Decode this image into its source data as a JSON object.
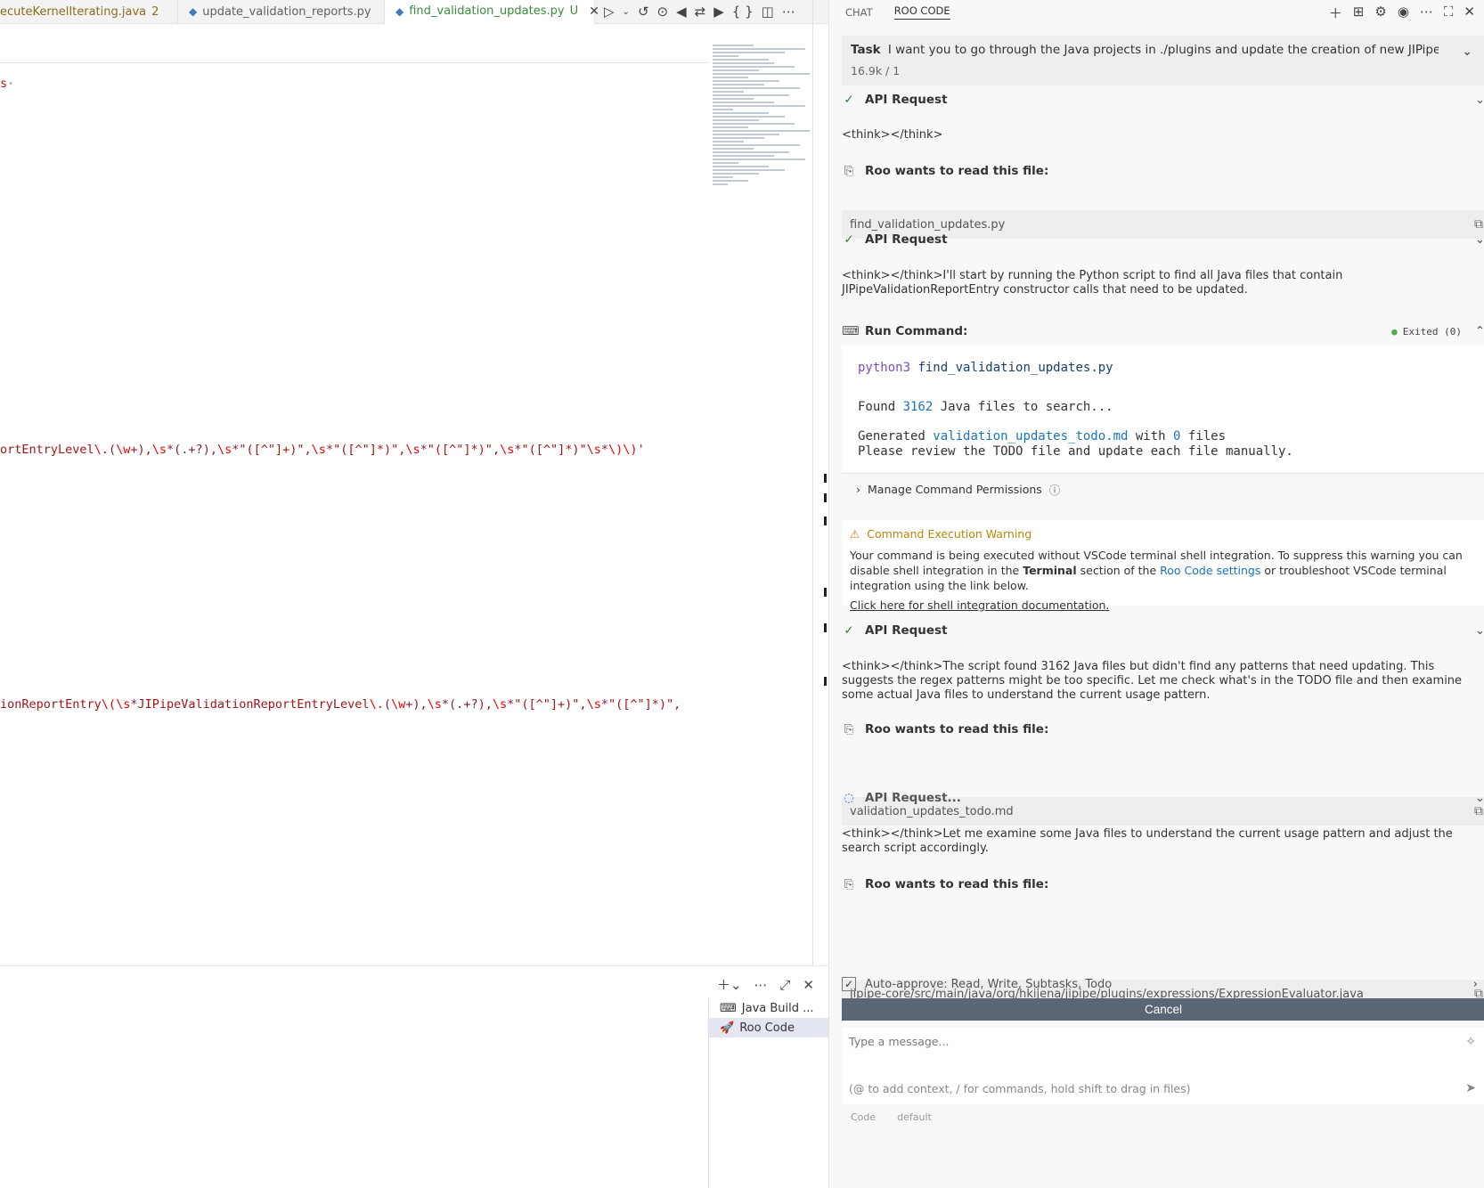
{
  "editor": {
    "tabs": [
      {
        "label": "ecuteKernelIterating.java",
        "badge": "2"
      },
      {
        "label": "update_validation_reports.py"
      },
      {
        "label": "find_validation_updates.py",
        "badge": "U"
      }
    ],
    "code_lines": [
      {
        "parts": [
          {
            "t": "s",
            "c": "str"
          },
          {
            "t": "·",
            "c": "dim"
          }
        ]
      },
      {
        "parts": [
          {
            "t": "ortEntryLevel",
            "c": "str"
          },
          {
            "t": "\\.",
            "c": "esc"
          },
          {
            "t": "(",
            "c": "grp"
          },
          {
            "t": "\\w",
            "c": "esc"
          },
          {
            "t": "+)",
            "c": "grp"
          },
          {
            "t": ",",
            "c": "str"
          },
          {
            "t": "\\s",
            "c": "esc"
          },
          {
            "t": "*",
            "c": "grp"
          },
          {
            "t": "(.",
            "c": "grp"
          },
          {
            "t": "+?",
            "c": "grp"
          },
          {
            "t": ")",
            "c": "grp"
          },
          {
            "t": ",",
            "c": "str"
          },
          {
            "t": "\\s",
            "c": "esc"
          },
          {
            "t": "*",
            "c": "grp"
          },
          {
            "t": "\"([^\"]+)\"",
            "c": "str"
          },
          {
            "t": ",",
            "c": "str"
          },
          {
            "t": "\\s",
            "c": "esc"
          },
          {
            "t": "*",
            "c": "grp"
          },
          {
            "t": "\"([^\"]*)\"",
            "c": "str"
          },
          {
            "t": ",",
            "c": "str"
          },
          {
            "t": "\\s",
            "c": "esc"
          },
          {
            "t": "*",
            "c": "grp"
          },
          {
            "t": "\"([^\"]*)\"",
            "c": "str"
          },
          {
            "t": ",",
            "c": "str"
          },
          {
            "t": "\\s",
            "c": "esc"
          },
          {
            "t": "*",
            "c": "grp"
          },
          {
            "t": "\"([^\"]*)\"",
            "c": "str"
          },
          {
            "t": "\\s",
            "c": "esc"
          },
          {
            "t": "*",
            "c": "grp"
          },
          {
            "t": "\\)\\)",
            "c": "esc"
          },
          {
            "t": "'",
            "c": "str"
          }
        ]
      },
      {
        "parts": [
          {
            "t": "ionReportEntry",
            "c": "str"
          },
          {
            "t": "\\(",
            "c": "esc"
          },
          {
            "t": "\\s",
            "c": "esc"
          },
          {
            "t": "*",
            "c": "grp"
          },
          {
            "t": "JIPipeValidationReportEntryLevel",
            "c": "str"
          },
          {
            "t": "\\.",
            "c": "esc"
          },
          {
            "t": "(",
            "c": "grp"
          },
          {
            "t": "\\w",
            "c": "esc"
          },
          {
            "t": "+)",
            "c": "grp"
          },
          {
            "t": ",",
            "c": "str"
          },
          {
            "t": "\\s",
            "c": "esc"
          },
          {
            "t": "*",
            "c": "grp"
          },
          {
            "t": "(.",
            "c": "grp"
          },
          {
            "t": "+?",
            "c": "grp"
          },
          {
            "t": ")",
            "c": "grp"
          },
          {
            "t": ",",
            "c": "str"
          },
          {
            "t": "\\s",
            "c": "esc"
          },
          {
            "t": "*",
            "c": "grp"
          },
          {
            "t": "\"([^\"]+)\"",
            "c": "str"
          },
          {
            "t": ",",
            "c": "str"
          },
          {
            "t": "\\s",
            "c": "esc"
          },
          {
            "t": "*",
            "c": "grp"
          },
          {
            "t": "\"([^\"]*)\"",
            "c": "str"
          },
          {
            "t": ",",
            "c": "str"
          }
        ]
      }
    ]
  },
  "panel": {
    "terminals": [
      {
        "label": "Java Build ...",
        "icon": "terminal-icon"
      },
      {
        "label": "Roo Code",
        "icon": "rocket-icon",
        "selected": true
      }
    ]
  },
  "side": {
    "tabs": [
      "CHAT",
      "ROO CODE"
    ],
    "task": {
      "label": "Task",
      "text": "I want you to go through the Java projects in ./plugins and update the creation of new JIPipeValidationRepo",
      "meta": "16.9k / 1"
    },
    "messages": {
      "api1": "API Request",
      "think1": "<think></think>",
      "read1_title": "Roo wants to read this file:",
      "read1_file": "find_validation_updates.py",
      "api2": "API Request",
      "think2": "<think></think>I'll start by running the Python script to find all Java files that contain JIPipeValidationReportEntry constructor calls that need to be updated.",
      "run_title": "Run Command:",
      "exit_status": "Exited (0)",
      "cmd_prog": "python3",
      "cmd_arg": "find_validation_updates.py",
      "out1_a": "Found ",
      "out1_num": "3162",
      "out1_b": " Java files to search...",
      "out2_a": "Generated ",
      "out2_file": "validation_updates_todo.md",
      "out2_b": " with ",
      "out2_num": "0",
      "out2_c": " files",
      "out3": "Please review the TODO file and update each file manually.",
      "perm": "Manage Command Permissions",
      "warn_title": "Command Execution Warning",
      "warn_a": "Your command is being executed without VSCode terminal shell integration. To suppress this warning you can disable shell integration in the ",
      "warn_b": "Terminal",
      "warn_c": " section of the ",
      "warn_link": "Roo Code settings",
      "warn_d": " or troubleshoot VSCode terminal integration using the link below.",
      "warn_doc": "Click here for shell integration documentation.",
      "api3": "API Request",
      "think3": "<think></think>The script found 3162 Java files but didn't find any patterns that need updating. This suggests the regex patterns might be too specific. Let me check what's in the TODO file and then examine some actual Java files to understand the current usage pattern.",
      "read2_title": "Roo wants to read this file:",
      "read2_file": "validation_updates_todo.md",
      "api4": "API Request...",
      "think4": "<think></think>Let me examine some Java files to understand the current usage pattern and adjust the search script accordingly.",
      "read3_title": "Roo wants to read this file:",
      "read3_file": "jipipe-core/src/main/java/org/hkijena/jipipe/plugins/expressions/ExpressionEvaluator.java"
    },
    "auto_approve_label": "Auto-approve:",
    "auto_approve_value": "Read, Write, Subtasks, Todo",
    "cancel": "Cancel",
    "input_placeholder": "Type a message...",
    "input_hint": "(@ to add context, / for commands, hold shift to drag in files)",
    "footer_mode": "Code",
    "footer_profile": "default"
  }
}
